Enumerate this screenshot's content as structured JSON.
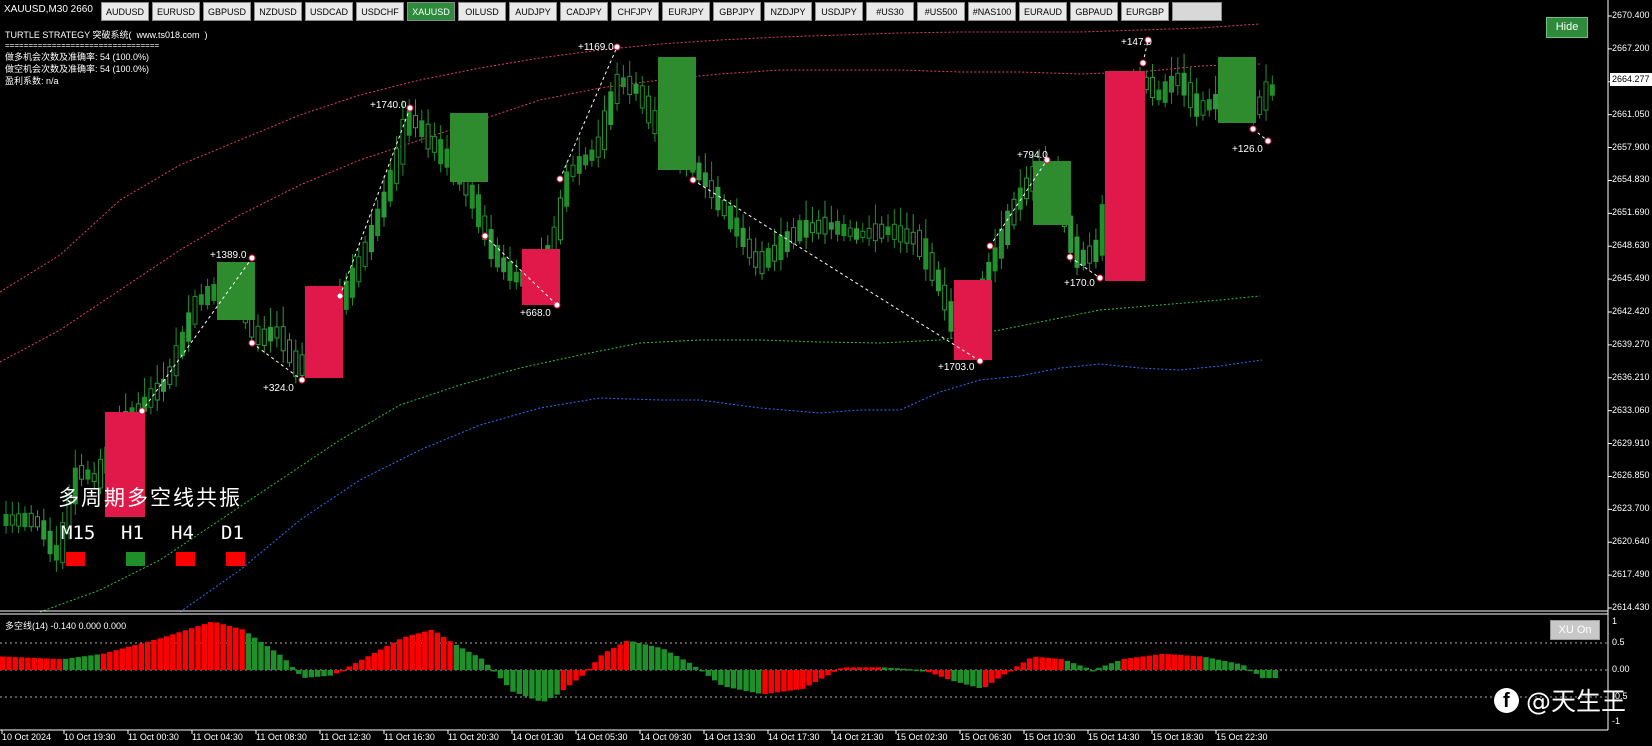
{
  "symbol_bar": {
    "title": "XAUUSD,M30  2660",
    "tabs": [
      "AUDUSD",
      "EURUSD",
      "GBPUSD",
      "NZDUSD",
      "USDCAD",
      "USDCHF",
      "XAUUSD",
      "OILUSD",
      "AUDJPY",
      "CADJPY",
      "CHFJPY",
      "EURJPY",
      "GBPJPY",
      "NZDJPY",
      "USDJPY",
      "#US30",
      "#US500",
      "#NAS100",
      "EURAUD",
      "GBPAUD",
      "EURGBP",
      ""
    ],
    "active": "XAUUSD"
  },
  "info": {
    "line1": "TURTLE STRATEGY 突破系统(  www.ts018.com  )",
    "line2": "=================================",
    "line3": "做多机会次数及准确率: 54 (100.0%)",
    "line4": "做空机会次数及准确率: 54 (100.0%)",
    "line5": "盈利系数: n/a"
  },
  "buttons": {
    "hide": "Hide",
    "xu_on": "XU On"
  },
  "resonance": {
    "title": "多周期多空线共振",
    "timeframes": [
      {
        "label": "M15",
        "color": "#ff0000"
      },
      {
        "label": "H1",
        "color": "#1f8f2a"
      },
      {
        "label": "H4",
        "color": "#ff0000"
      },
      {
        "label": "D1",
        "color": "#ff0000"
      }
    ]
  },
  "price_axis": {
    "labels": [
      "2670.400",
      "2667.200",
      "2664.277",
      "2661.050",
      "2657.900",
      "2654.830",
      "2651.690",
      "2648.630",
      "2645.490",
      "2642.420",
      "2639.270",
      "2636.210",
      "2633.060",
      "2629.910",
      "2626.850",
      "2623.700",
      "2620.640",
      "2617.490",
      "2614.430"
    ],
    "current": "2664.277"
  },
  "time_axis": [
    "10 Oct 2024",
    "10 Oct 19:30",
    "11 Oct 00:30",
    "11 Oct 04:30",
    "11 Oct 08:30",
    "11 Oct 12:30",
    "11 Oct 16:30",
    "11 Oct 20:30",
    "14 Oct 01:30",
    "14 Oct 05:30",
    "14 Oct 09:30",
    "14 Oct 13:30",
    "14 Oct 17:30",
    "14 Oct 21:30",
    "15 Oct 02:30",
    "15 Oct 06:30",
    "15 Oct 10:30",
    "15 Oct 14:30",
    "15 Oct 18:30",
    "15 Oct 22:30"
  ],
  "trades": [
    "+1389.0",
    "+324.0",
    "+1740.0",
    "+668.0",
    "+1169.0",
    "+1703.0",
    "+794.0",
    "+170.0",
    "+147.0",
    "+126.0"
  ],
  "indicator": {
    "title": "多空线(14) -0.140 0.000 0.000",
    "levels": [
      "1",
      "0.5",
      "0.00",
      "-0.5",
      "-1"
    ],
    "up_color": "#ff0000",
    "down_color": "#1f8f2a"
  },
  "watermark": "@天生王"
}
